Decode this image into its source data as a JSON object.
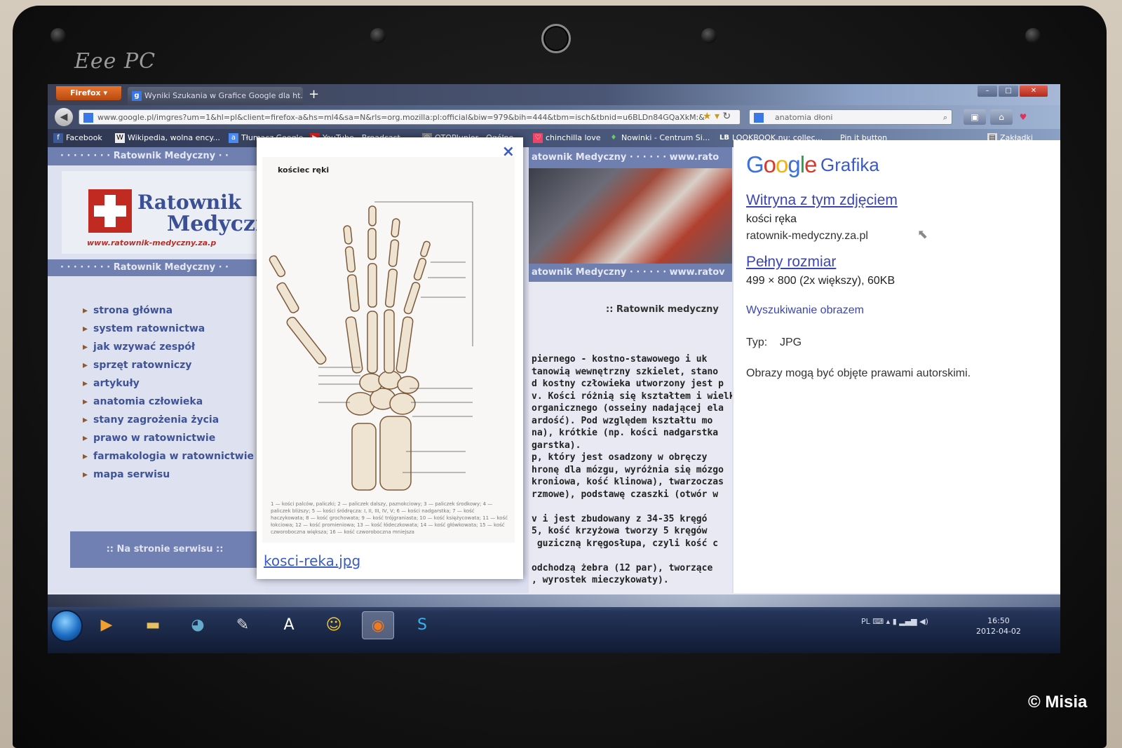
{
  "device": {
    "brand": "Eee PC",
    "watermark": "© Misia"
  },
  "browser": {
    "menu_label": "Firefox",
    "tab_title": "Wyniki Szukania w Grafice Google dla ht...",
    "new_tab": "+",
    "url": "www.google.pl/imgres?um=1&hl=pl&client=firefox-a&hs=ml4&sa=N&rls=org.mozilla:pl:official&biw=979&bih=444&tbm=isch&tbnid=u6BLDn84GQaXkM:&",
    "search_query": "anatomia dłoni",
    "bookmarks": [
      "Facebook",
      "Wikipedia, wolna ency...",
      "Tłumacz Google",
      "YouTube - Broadcast ...",
      "OTOPJunior - Ogólno...",
      "chinchilla love",
      "Nowinki - Centrum Si...",
      "LOOKBOOK.nu: collec...",
      "Pin it button",
      "Zakładki"
    ]
  },
  "site": {
    "banner": "· · · · · · · ·  Ratownik Medyczny  · ·",
    "logo_line1": "Ratownik",
    "logo_line2": "Medyczny",
    "logo_url": "www.ratownik-medyczny.za.p",
    "banner2": "· · · · · · · ·  Ratownik Medyczny  · ·",
    "nav": [
      "strona główna",
      "system ratownictwa",
      "jak wzywać zespół",
      "sprzęt ratowniczy",
      "artykuły",
      "anatomia człowieka",
      "stany zagrożenia życia",
      "prawo w ratownictwie",
      "farmakologia w ratownictwie",
      "mapa serwisu"
    ],
    "na_stronie": ":: Na stronie serwisu ::",
    "mid_banner": "atownik Medyczny · · · · · · www.rato",
    "mid_banner2": "atownik Medyczny · · · · · · www.ratov",
    "mid_heading": ":: Ratownik medyczny",
    "mid_text": "piernego - kostno-stawowego i uk\ntanowią wewnętrzny szkielet, stano\nd kostny człowieka utworzony jest p\nv. Kości różnią się kształtem i wielkoś\norganicznego (osseiny nadającej ela\nardość). Pod względem kształtu mo\nna), krótkie (np. kości nadgarstka\ngarstka).\np, który jest osadzony w obręczy\nhronę dla mózgu, wyróżnia się mózgo\nkroniowa, kość klinowa), twarzoczas\nrzmowe), podstawę czaszki (otwór w\n\nv i jest zbudowany z 34-35 kręgó\n5, kość krzyżowa tworzy 5 kręgów\n guziczną kręgosłupa, czyli kość c\n\nodchodzą żebra (12 par), tworzące\n, wyrostek mieczykowaty)."
  },
  "lightbox": {
    "close": "×",
    "caption": "kościec ręki",
    "legend": "1 — kości palców, paliczki; 2 — paliczek dalszy, paznokciowy; 3 — paliczek środkowy; 4 — paliczek bliższy; 5 — kości śródręcza: I, II, III, IV, V; 6 — kości nadgarstka; 7 — kość haczykowata; 8 — kość grochowata; 9 — kość trójgraniasta; 10 — kość księżycowata; 11 — kość łokciowa; 12 — kość promieniowa; 13 — kość łódeczkowata; 14 — kość główkowata; 15 — kość czworoboczna większa; 16 — kość czworoboczna mniejsza",
    "filename": "kosci-reka.jpg"
  },
  "google_panel": {
    "logo": "Google",
    "product": "Grafika",
    "site_link": "Witryna z tym zdjęciem",
    "page_title": "kości ręka",
    "domain": "ratownik-medyczny.za.pl",
    "full_size_link": "Pełny rozmiar",
    "size_info": "499 × 800 (2x większy), 60KB",
    "search_by_image": "Wyszukiwanie obrazem",
    "type_label": "Typ:",
    "type_value": "JPG",
    "copyright_note": "Obrazy mogą być objęte prawami autorskimi."
  },
  "taskbar": {
    "language": "PL",
    "time": "16:50",
    "date": "2012-04-02"
  }
}
